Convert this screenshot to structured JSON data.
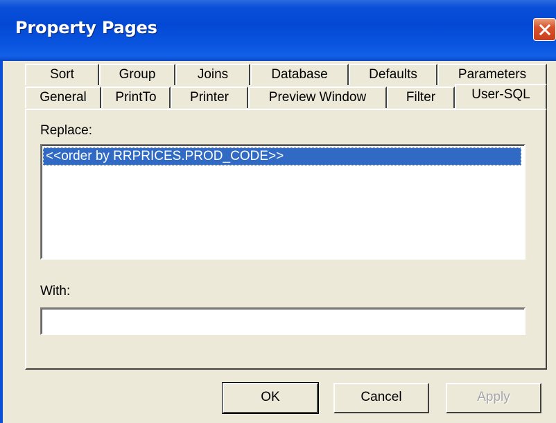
{
  "window": {
    "title": "Property Pages"
  },
  "tabs_back": [
    "Sort",
    "Group",
    "Joins",
    "Database",
    "Defaults",
    "Parameters"
  ],
  "tabs_front": [
    "General",
    "PrintTo",
    "Printer",
    "Preview Window",
    "Filter",
    "User-SQL"
  ],
  "active_tab": "User-SQL",
  "replace": {
    "label": "Replace:",
    "items": [
      "<<order by RRPRICES.PROD_CODE>>"
    ]
  },
  "with": {
    "label": "With:",
    "value": ""
  },
  "buttons": {
    "ok": "OK",
    "cancel": "Cancel",
    "apply": "Apply"
  },
  "colors": {
    "title_bar": "#0A4FD8",
    "face": "#ECE9D8",
    "selection": "#316AC5",
    "close": "#D8532C"
  }
}
